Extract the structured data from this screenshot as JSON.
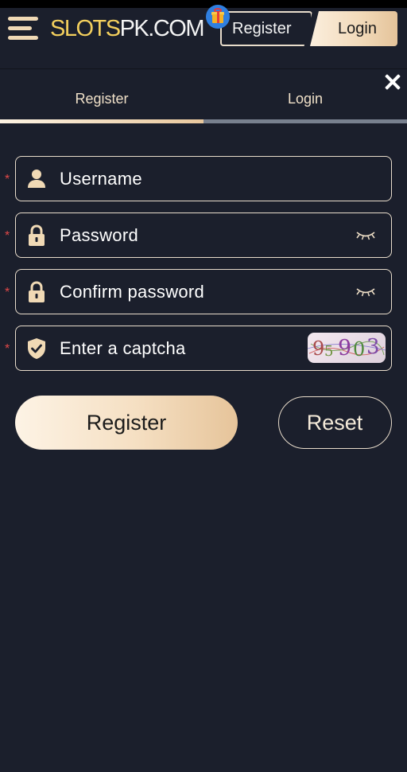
{
  "header": {
    "logo_part1": "SLOTS",
    "logo_part2": "PK.COM",
    "register_label": "Register",
    "login_label": "Login",
    "gift_icon": "gift-icon",
    "menu_icon": "hamburger-menu-icon"
  },
  "tabs": [
    {
      "label": "Register",
      "active": true
    },
    {
      "label": "Login",
      "active": false
    }
  ],
  "form": {
    "required_marker": "*",
    "username_placeholder": "Username",
    "password_placeholder": "Password",
    "confirm_password_placeholder": "Confirm password",
    "captcha_placeholder": "Enter a captcha",
    "captcha_code": "95903",
    "register_button": "Register",
    "reset_button": "Reset"
  },
  "colors": {
    "background": "#1b1f2c",
    "accent_gold": "#f0d9b5",
    "logo_yellow": "#f3cf5d",
    "required_red": "#e04848"
  }
}
